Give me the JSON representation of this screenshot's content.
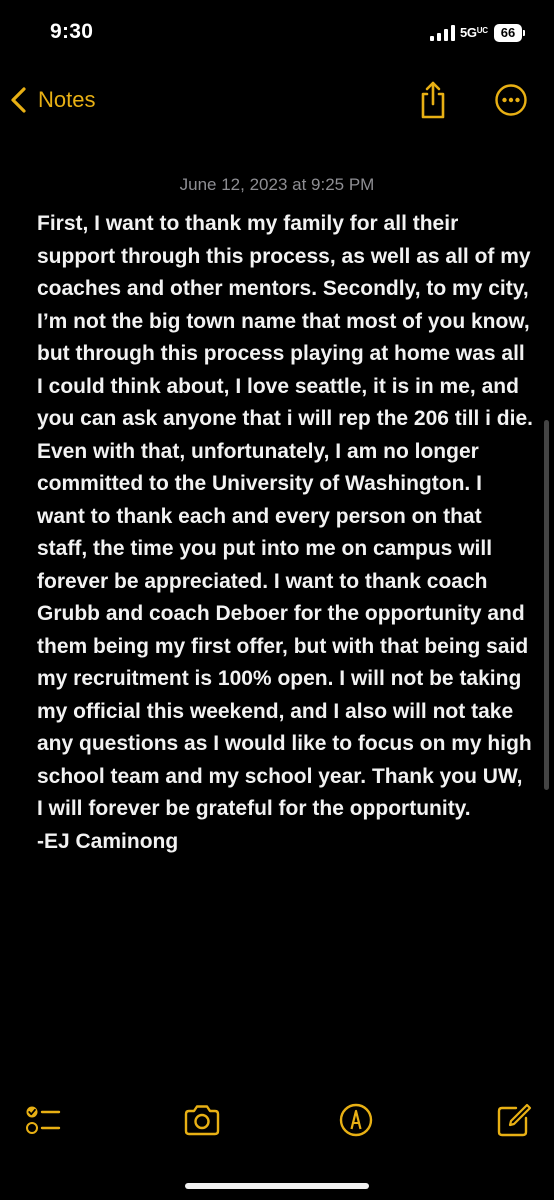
{
  "status_bar": {
    "time": "9:30",
    "network": "5G",
    "network_suffix": "UC",
    "battery": "66"
  },
  "nav": {
    "back_label": "Notes",
    "icons": [
      "chevron-left-icon",
      "share-icon",
      "more-icon"
    ]
  },
  "note": {
    "date": "June 12, 2023 at 9:25 PM",
    "body": "First, I want to thank my family for all their support through this process, as well as all of my coaches and other mentors. Secondly, to my city, I’m not the big town name that most of you know, but through this process playing at home was all I could think about, I love seattle, it is in me, and you can ask anyone that i will rep the 206 till i die. Even with that, unfortunately,  I am no longer committed to the University of Washington. I want to thank each and every person on that staff, the time you put into me on campus will forever be appreciated. I want to thank coach Grubb and coach Deboer for the opportunity and them being my first offer, but with that being said my recruitment is 100% open. I will not be taking my official this weekend, and I also will not take any questions as I would like to focus on my high school team and my school year. Thank you UW, I will forever be grateful for the opportunity.\n-EJ Caminong"
  },
  "toolbar": {
    "icons": [
      "checklist-icon",
      "camera-icon",
      "markup-icon",
      "compose-icon"
    ]
  },
  "colors": {
    "accent": "#e8b014",
    "background": "#000000",
    "text": "#f2f2f2",
    "secondary_text": "#8e8e93"
  }
}
